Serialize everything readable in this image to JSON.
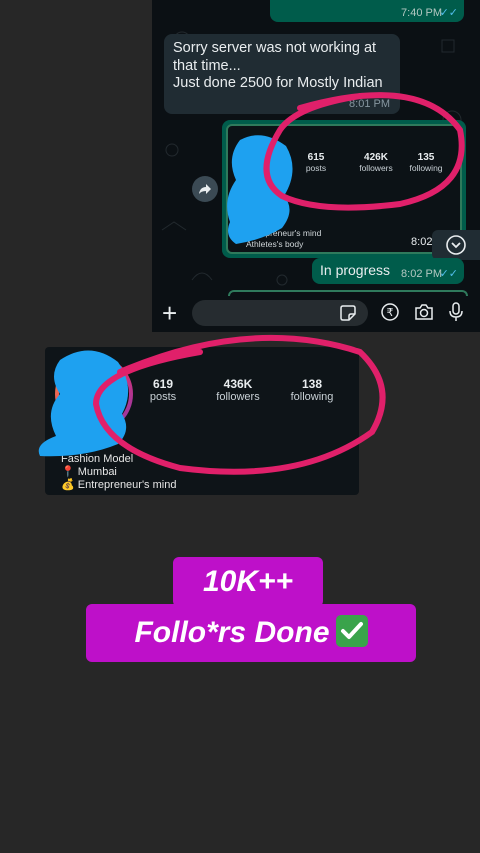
{
  "chat": {
    "top_message": {
      "text": "",
      "time": "7:40 PM"
    },
    "incoming_message": {
      "text": "Sorry server was not working at that time...\nJust done 2500  for Mostly Indian",
      "time": "8:01 PM"
    },
    "image_message": {
      "stats": [
        {
          "value": "615",
          "label": "posts"
        },
        {
          "value": "426K",
          "label": "followers"
        },
        {
          "value": "135",
          "label": "following"
        }
      ],
      "bio": [
        "entrepreneur's mind",
        "Athletes's body"
      ],
      "time": "8:02 PM"
    },
    "progress_message": {
      "text": "In progress",
      "time": "8:02 PM"
    }
  },
  "input_bar": {
    "icons": [
      "plus-icon",
      "sticker-icon",
      "rupee-icon",
      "camera-icon",
      "mic-icon"
    ]
  },
  "profile": {
    "stats": [
      {
        "value": "619",
        "label": "posts"
      },
      {
        "value": "436K",
        "label": "followers"
      },
      {
        "value": "138",
        "label": "following"
      }
    ],
    "bio": [
      "Fashion Model",
      "📍 Mumbai",
      "💰 Entrepreneur's mind"
    ]
  },
  "caption": {
    "line1": "10K++",
    "line2": "Follo*rs Done"
  },
  "colors": {
    "background": "#272727",
    "highlight_circle": "#e0206a",
    "scribble": "#1ea1f0",
    "caption_bg": "#be10c9",
    "outgoing_bubble": "#005c4b",
    "incoming_bubble": "#202c33"
  }
}
